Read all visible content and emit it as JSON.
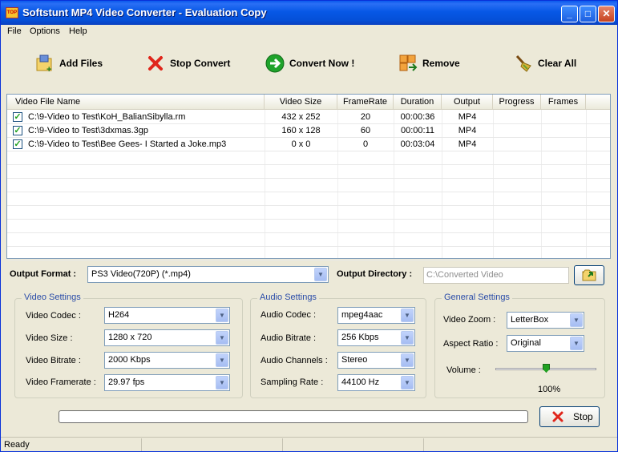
{
  "window": {
    "title": "Softstunt MP4 Video Converter - Evaluation Copy",
    "icon_text": "TOP"
  },
  "menu": [
    "File",
    "Options",
    "Help"
  ],
  "toolbar": {
    "add_files": "Add Files",
    "stop_convert": "Stop Convert",
    "convert_now": "Convert Now !",
    "remove": "Remove",
    "clear_all": "Clear All"
  },
  "files": {
    "columns": [
      "Video File Name",
      "Video Size",
      "FrameRate",
      "Duration",
      "Output",
      "Progress",
      "Frames"
    ],
    "rows": [
      {
        "name": "C:\\9-Video to Test\\KoH_BalianSibylla.rm",
        "size": "432 x 252",
        "framerate": "20",
        "duration": "00:00:36",
        "output": "MP4",
        "progress": "",
        "frames": "",
        "checked": true
      },
      {
        "name": "C:\\9-Video to Test\\3dxmas.3gp",
        "size": "160 x 128",
        "framerate": "60",
        "duration": "00:00:11",
        "output": "MP4",
        "progress": "",
        "frames": "",
        "checked": true
      },
      {
        "name": "C:\\9-Video to Test\\Bee Gees- I Started a Joke.mp3",
        "size": "0 x 0",
        "framerate": "0",
        "duration": "00:03:04",
        "output": "MP4",
        "progress": "",
        "frames": "",
        "checked": true
      }
    ]
  },
  "output": {
    "format_label": "Output Format :",
    "format_value": "PS3 Video(720P) (*.mp4)",
    "directory_label": "Output Directory :",
    "directory_value": "C:\\Converted Video"
  },
  "video": {
    "title": "Video Settings",
    "codec_label": "Video Codec :",
    "codec": "H264",
    "size_label": "Video Size :",
    "size": "1280 x 720",
    "bitrate_label": "Video Bitrate :",
    "bitrate": "2000 Kbps",
    "framerate_label": "Video Framerate :",
    "framerate": "29.97 fps"
  },
  "audio": {
    "title": "Audio Settings",
    "codec_label": "Audio Codec :",
    "codec": "mpeg4aac",
    "bitrate_label": "Audio Bitrate :",
    "bitrate": "256 Kbps",
    "channels_label": "Audio Channels :",
    "channels": "Stereo",
    "sampling_label": "Sampling Rate :",
    "sampling": "44100 Hz"
  },
  "general": {
    "title": "General Settings",
    "zoom_label": "Video Zoom :",
    "zoom": "LetterBox",
    "aspect_label": "Aspect Ratio :",
    "aspect": "Original",
    "volume_label": "Volume :",
    "volume": "100%",
    "volume_fraction": 0.5
  },
  "progress": {
    "fraction": 0
  },
  "stop_label": "Stop",
  "status": "Ready",
  "colors": {
    "title_blue": "#0758e6",
    "group_title": "#2a4ca8",
    "check_green": "#21a121"
  }
}
